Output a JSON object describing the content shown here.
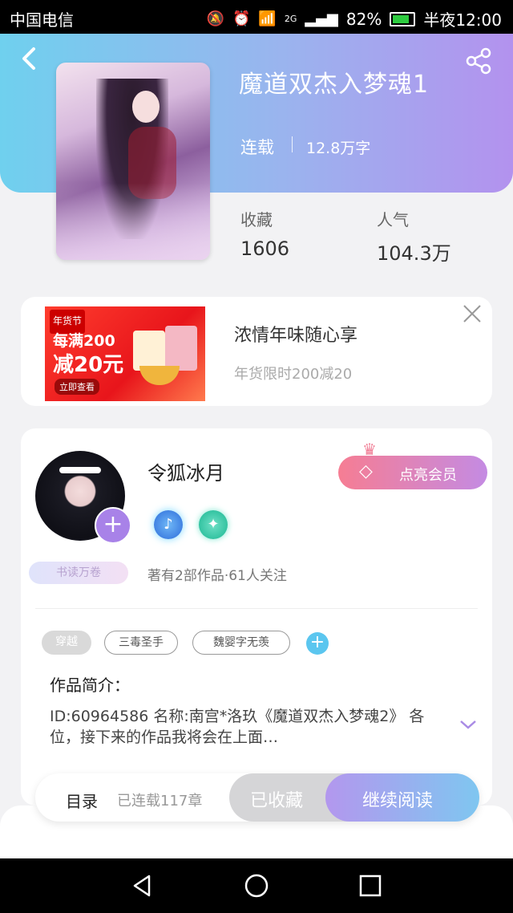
{
  "status_bar": {
    "carrier": "中国电信",
    "network": "2G",
    "battery": "82%",
    "time": "半夜12:00"
  },
  "book": {
    "title": "魔道双杰入梦魂1",
    "status": "连载",
    "word_count": "12.8万字",
    "favorites_label": "收藏",
    "favorites_value": "1606",
    "popularity_label": "人气",
    "popularity_value": "104.3万"
  },
  "ad": {
    "image_tag": "年货节",
    "image_line1": "每满200",
    "image_line2": "减20元",
    "image_button": "立即查看",
    "title": "浓情年味随心享",
    "subtitle": "年货限时200减20"
  },
  "author": {
    "name": "令狐冰月",
    "reader_badge": "书读万卷",
    "vip_button": "点亮会员",
    "stats": "著有2部作品·61人关注",
    "tags": [
      "穿越",
      "三毒圣手",
      "魏婴字无羡"
    ],
    "intro_label": "作品简介：",
    "intro_text": "ID:60964586 名称:南宫*洛玖《魔道双杰入梦魂2》 各位，接下来的作品我将会在上面…"
  },
  "action_bar": {
    "catalog": "目录",
    "chapters": "已连载117章",
    "favorited": "已收藏",
    "continue_reading": "继续阅读"
  },
  "colors": {
    "header_gradient_start": "#6fd0ee",
    "header_gradient_end": "#b392ee",
    "accent_purple": "#a882e8",
    "vip_pink": "#f67d93"
  }
}
